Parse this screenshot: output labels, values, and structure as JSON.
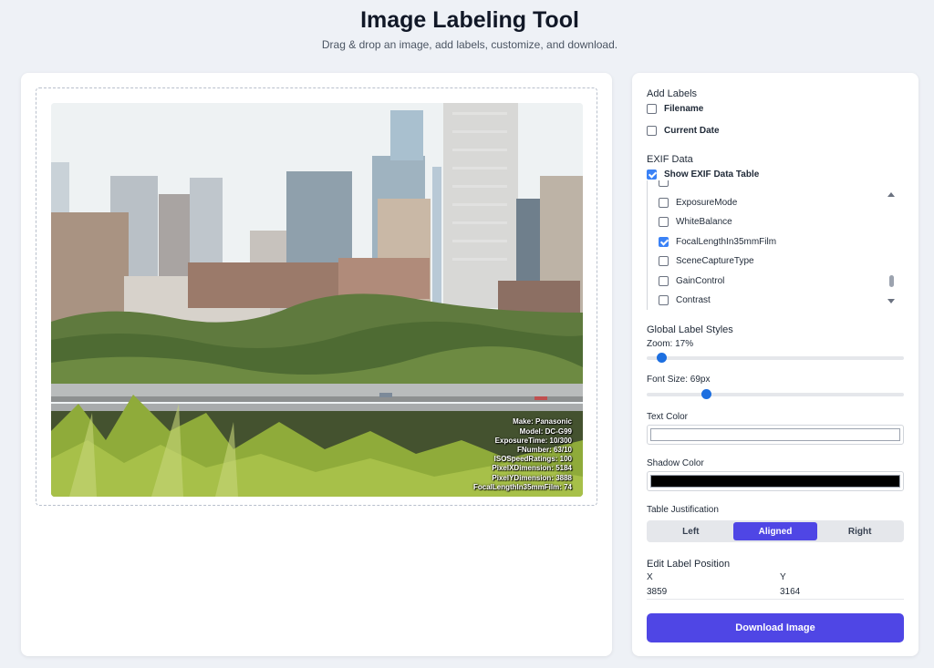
{
  "header": {
    "title": "Image Labeling Tool",
    "subtitle": "Drag & drop an image, add labels, customize, and download."
  },
  "image_overlay": {
    "lines": [
      "Make: Panasonic",
      "Model: DC-G99",
      "ExposureTime: 10/300",
      "FNumber: 63/10",
      "ISOSpeedRatings: 100",
      "PixelXDimension: 5184",
      "PixelYDimension: 3888",
      "FocalLengthIn35mmFilm: 74"
    ]
  },
  "add_labels": {
    "title": "Add Labels",
    "filename_label": "Filename",
    "filename_checked": false,
    "current_date_label": "Current Date",
    "current_date_checked": false
  },
  "exif": {
    "title": "EXIF Data",
    "show_table_label": "Show EXIF Data Table",
    "show_table_checked": true,
    "items": [
      {
        "label": "ExposureMode",
        "checked": false
      },
      {
        "label": "WhiteBalance",
        "checked": false
      },
      {
        "label": "FocalLengthIn35mmFilm",
        "checked": true
      },
      {
        "label": "SceneCaptureType",
        "checked": false
      },
      {
        "label": "GainControl",
        "checked": false
      },
      {
        "label": "Contrast",
        "checked": false
      }
    ]
  },
  "styles": {
    "title": "Global Label Styles",
    "zoom_label": "Zoom: 17%",
    "zoom_value": 0.04,
    "font_size_label": "Font Size: 69px",
    "font_size_value": 0.22,
    "text_color_label": "Text Color",
    "text_color": "#ffffff",
    "shadow_color_label": "Shadow Color",
    "shadow_color": "#000000"
  },
  "justification": {
    "title": "Table Justification",
    "options": [
      "Left",
      "Aligned",
      "Right"
    ],
    "selected": "Aligned"
  },
  "position": {
    "title": "Edit Label Position",
    "x_label": "X",
    "y_label": "Y",
    "x_value": "3859",
    "y_value": "3164"
  },
  "download": {
    "label": "Download Image"
  },
  "colors": {
    "accent": "#4f46e5",
    "checkbox": "#3b82f6"
  }
}
